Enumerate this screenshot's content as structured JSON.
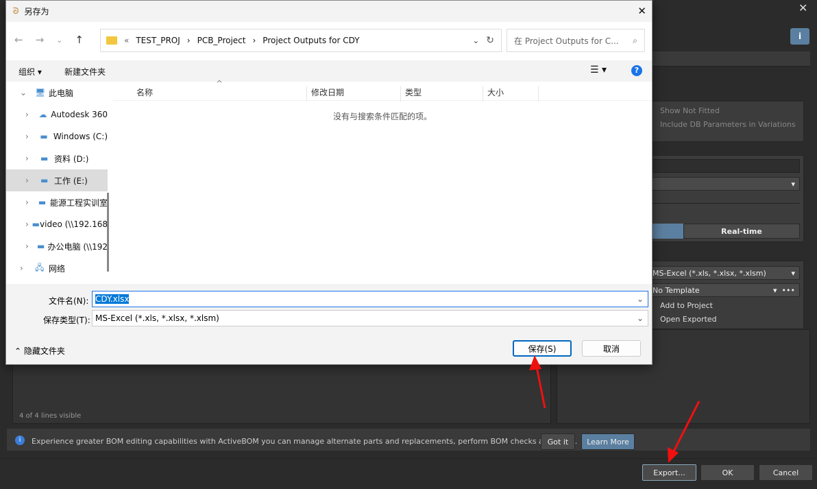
{
  "save_dialog": {
    "title": "另存为",
    "breadcrumb": [
      "TEST_PROJ",
      "PCB_Project",
      "Project Outputs for CDY"
    ],
    "search_placeholder": "在 Project Outputs for C...",
    "toolbar": {
      "organize": "组织",
      "new_folder": "新建文件夹"
    },
    "tree": [
      {
        "label": "此电脑",
        "icon": "computer-icon",
        "level": 0,
        "expanded": true
      },
      {
        "label": "Autodesk 360",
        "icon": "cloud-icon",
        "level": 1
      },
      {
        "label": "Windows (C:)",
        "icon": "drive-icon",
        "level": 1
      },
      {
        "label": "资料 (D:)",
        "icon": "drive-icon",
        "level": 1
      },
      {
        "label": "工作 (E:)",
        "icon": "drive-icon",
        "level": 1,
        "selected": true
      },
      {
        "label": "能源工程实训室",
        "icon": "drive-icon",
        "level": 1
      },
      {
        "label": "video (\\\\192.168",
        "icon": "network-drive-icon",
        "level": 1
      },
      {
        "label": "办公电脑 (\\\\192",
        "icon": "network-drive-icon",
        "level": 1
      },
      {
        "label": "网络",
        "icon": "network-icon",
        "level": 0
      }
    ],
    "columns": [
      "名称",
      "修改日期",
      "类型",
      "大小"
    ],
    "empty_message": "没有与搜索条件匹配的项。",
    "filename_label": "文件名(N):",
    "filename_value": "CDY.xlsx",
    "filetype_label": "保存类型(T):",
    "filetype_value": "MS-Excel (*.xls, *.xlsx, *.xlsm)",
    "hide_folders": "隐藏文件夹",
    "save": "保存(S)",
    "cancel": "取消"
  },
  "bom": {
    "show_not_fitted": "Show Not Fitted",
    "include_db": "Include DB Parameters in Variations",
    "realtime": "Real-time",
    "format": "MS-Excel (*.xls, *.xlsx, *.xlsm)",
    "template": "No Template",
    "add_to_project": "Add to Project",
    "open_exported": "Open Exported",
    "lines_visible": "4 of 4 lines visible",
    "info": "Experience greater BOM editing capabilities with ActiveBOM you can manage alternate parts and replacements, perform BOM checks and more.",
    "got_it": "Got it",
    "learn_more": "Learn More",
    "export": "Export...",
    "ok": "OK",
    "cancel": "Cancel",
    "accent": "#5b7fa0"
  }
}
